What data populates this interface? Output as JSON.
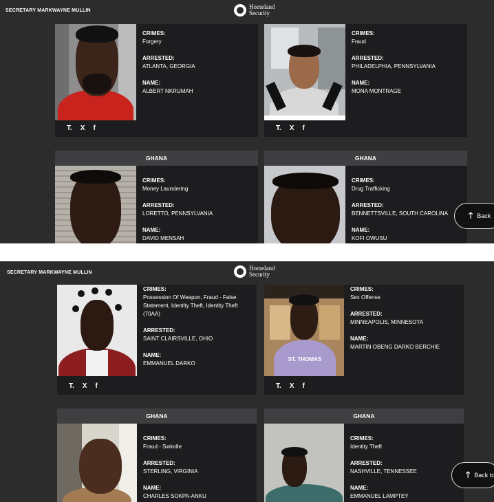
{
  "header": {
    "secretary": "SECRETARY MARKWAYNE MULLIN",
    "logo_line1": "Homeland",
    "logo_line2": "Security"
  },
  "labels": {
    "crimes": "CRIMES:",
    "arrested": "ARRESTED:",
    "name": "NAME:"
  },
  "social": {
    "truth": "T.",
    "x": "X",
    "facebook": "f"
  },
  "back_to_top": "Back to",
  "back_to_top_short": "Back",
  "screen1": {
    "cards": [
      {
        "country": "",
        "crimes": "Forgery",
        "arrested": "ATLANTA, GEORGIA",
        "name": "ALBERT NKRUMAH"
      },
      {
        "country": "",
        "crimes": "Fraud",
        "arrested": "PHILADELPHIA, PENNSYLVANIA",
        "name": "MONA MONTRAGE"
      },
      {
        "country": "GHANA",
        "crimes": "Money Laundering",
        "arrested": "LORETTO, PENNSYLVANIA",
        "name": "DAVID MENSAH"
      },
      {
        "country": "GHANA",
        "crimes": "Drug Trafficking",
        "arrested": "BENNETTSVILLE, SOUTH CAROLINA",
        "name": "KOFI OWUSU"
      }
    ]
  },
  "screen2": {
    "cards": [
      {
        "country": "",
        "crimes": "Possession Of Weapon, Fraud - False Statement, Identity Theft, Identity Theft (70AA)",
        "arrested": "SAINT CLAIRSVILLE, OHIO",
        "name": "EMMANUEL DARKO"
      },
      {
        "country": "",
        "crimes": "Sex Offense",
        "arrested": "MINNEAPOLIS, MINNESOTA",
        "name": "MARTIN OBENG DARKO BERCHIE"
      },
      {
        "country": "GHANA",
        "crimes": "Fraud - Swindle",
        "arrested": "STERLING, VIRGINIA",
        "name": "CHARLES SOKPA-ANKU"
      },
      {
        "country": "GHANA",
        "crimes": "Identity Theft",
        "arrested": "NASHVILLE, TENNESSEE",
        "name": "EMMANUEL LAMPTEY"
      }
    ]
  },
  "hoodie_text": "ST. THOMAS",
  "colors": {
    "page_bg": "#2c2c2c",
    "card_bg": "#1d1d1f",
    "card_header": "#3f3f42",
    "text": "#ffffff"
  }
}
